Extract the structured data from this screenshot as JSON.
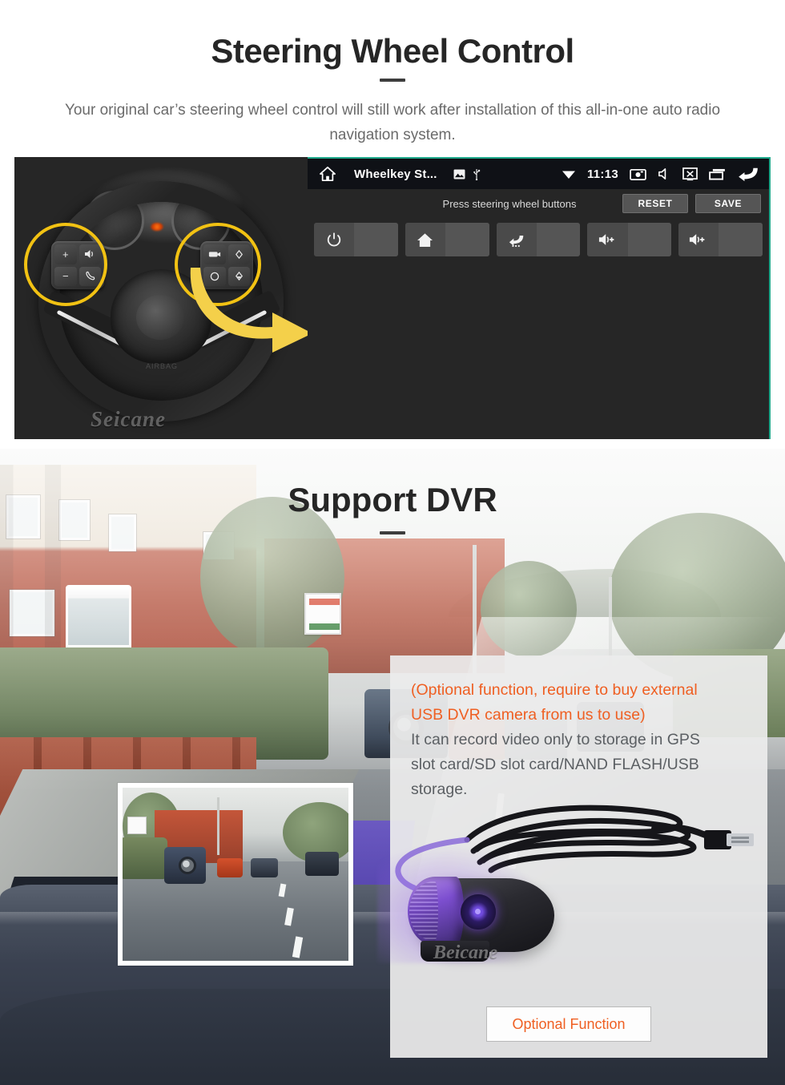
{
  "section_steering": {
    "title": "Steering Wheel Control",
    "subtitle": "Your original car’s steering wheel control will still work after installation of this all-in-one auto radio navigation system.",
    "photo": {
      "watermark": "Seicane",
      "airbag_label": "AIRBAG",
      "left_pad_keys": [
        "+",
        "−",
        "voice-icon",
        "phone-icon"
      ],
      "right_pad_keys": [
        "media-icon",
        "up-icon",
        "mode-icon",
        "down-icon"
      ],
      "highlight_color": "#f2c213",
      "arrow_color": "#f4d04a"
    },
    "unit": {
      "statusbar": {
        "home_icon": "home-icon",
        "app_title": "Wheelkey St...",
        "gallery_icon": "image-icon",
        "usb_icon": "usb-icon",
        "wifi_icon": "wifi-icon",
        "time": "11:13",
        "screenshot_icon": "camera-icon",
        "mute_icon": "mute-icon",
        "screenoff_icon": "screen-off-icon",
        "recents_icon": "recents-icon",
        "back_icon": "back-icon"
      },
      "toolbar": {
        "hint": "Press steering wheel buttons",
        "reset_label": "RESET",
        "save_label": "SAVE"
      },
      "keys": [
        {
          "icon": "power-icon",
          "value": ""
        },
        {
          "icon": "home-icon",
          "value": ""
        },
        {
          "icon": "back-icon",
          "value": ""
        },
        {
          "icon": "volume-up-icon",
          "value": ""
        },
        {
          "icon": "volume-up-icon",
          "value": ""
        }
      ],
      "accent_color": "#1fa98b"
    }
  },
  "section_dvr": {
    "title": "Support DVR",
    "panel": {
      "orange_lines": [
        "(Optional function, require to buy external",
        "USB DVR camera from us to use)"
      ],
      "grey_lines": [
        "It can record video only to storage in GPS",
        "slot card/SD slot card/NAND FLASH/USB",
        "storage."
      ],
      "product_watermark": "Beicane",
      "button_label": "Optional Function",
      "orange_color": "#ef5f22"
    }
  }
}
